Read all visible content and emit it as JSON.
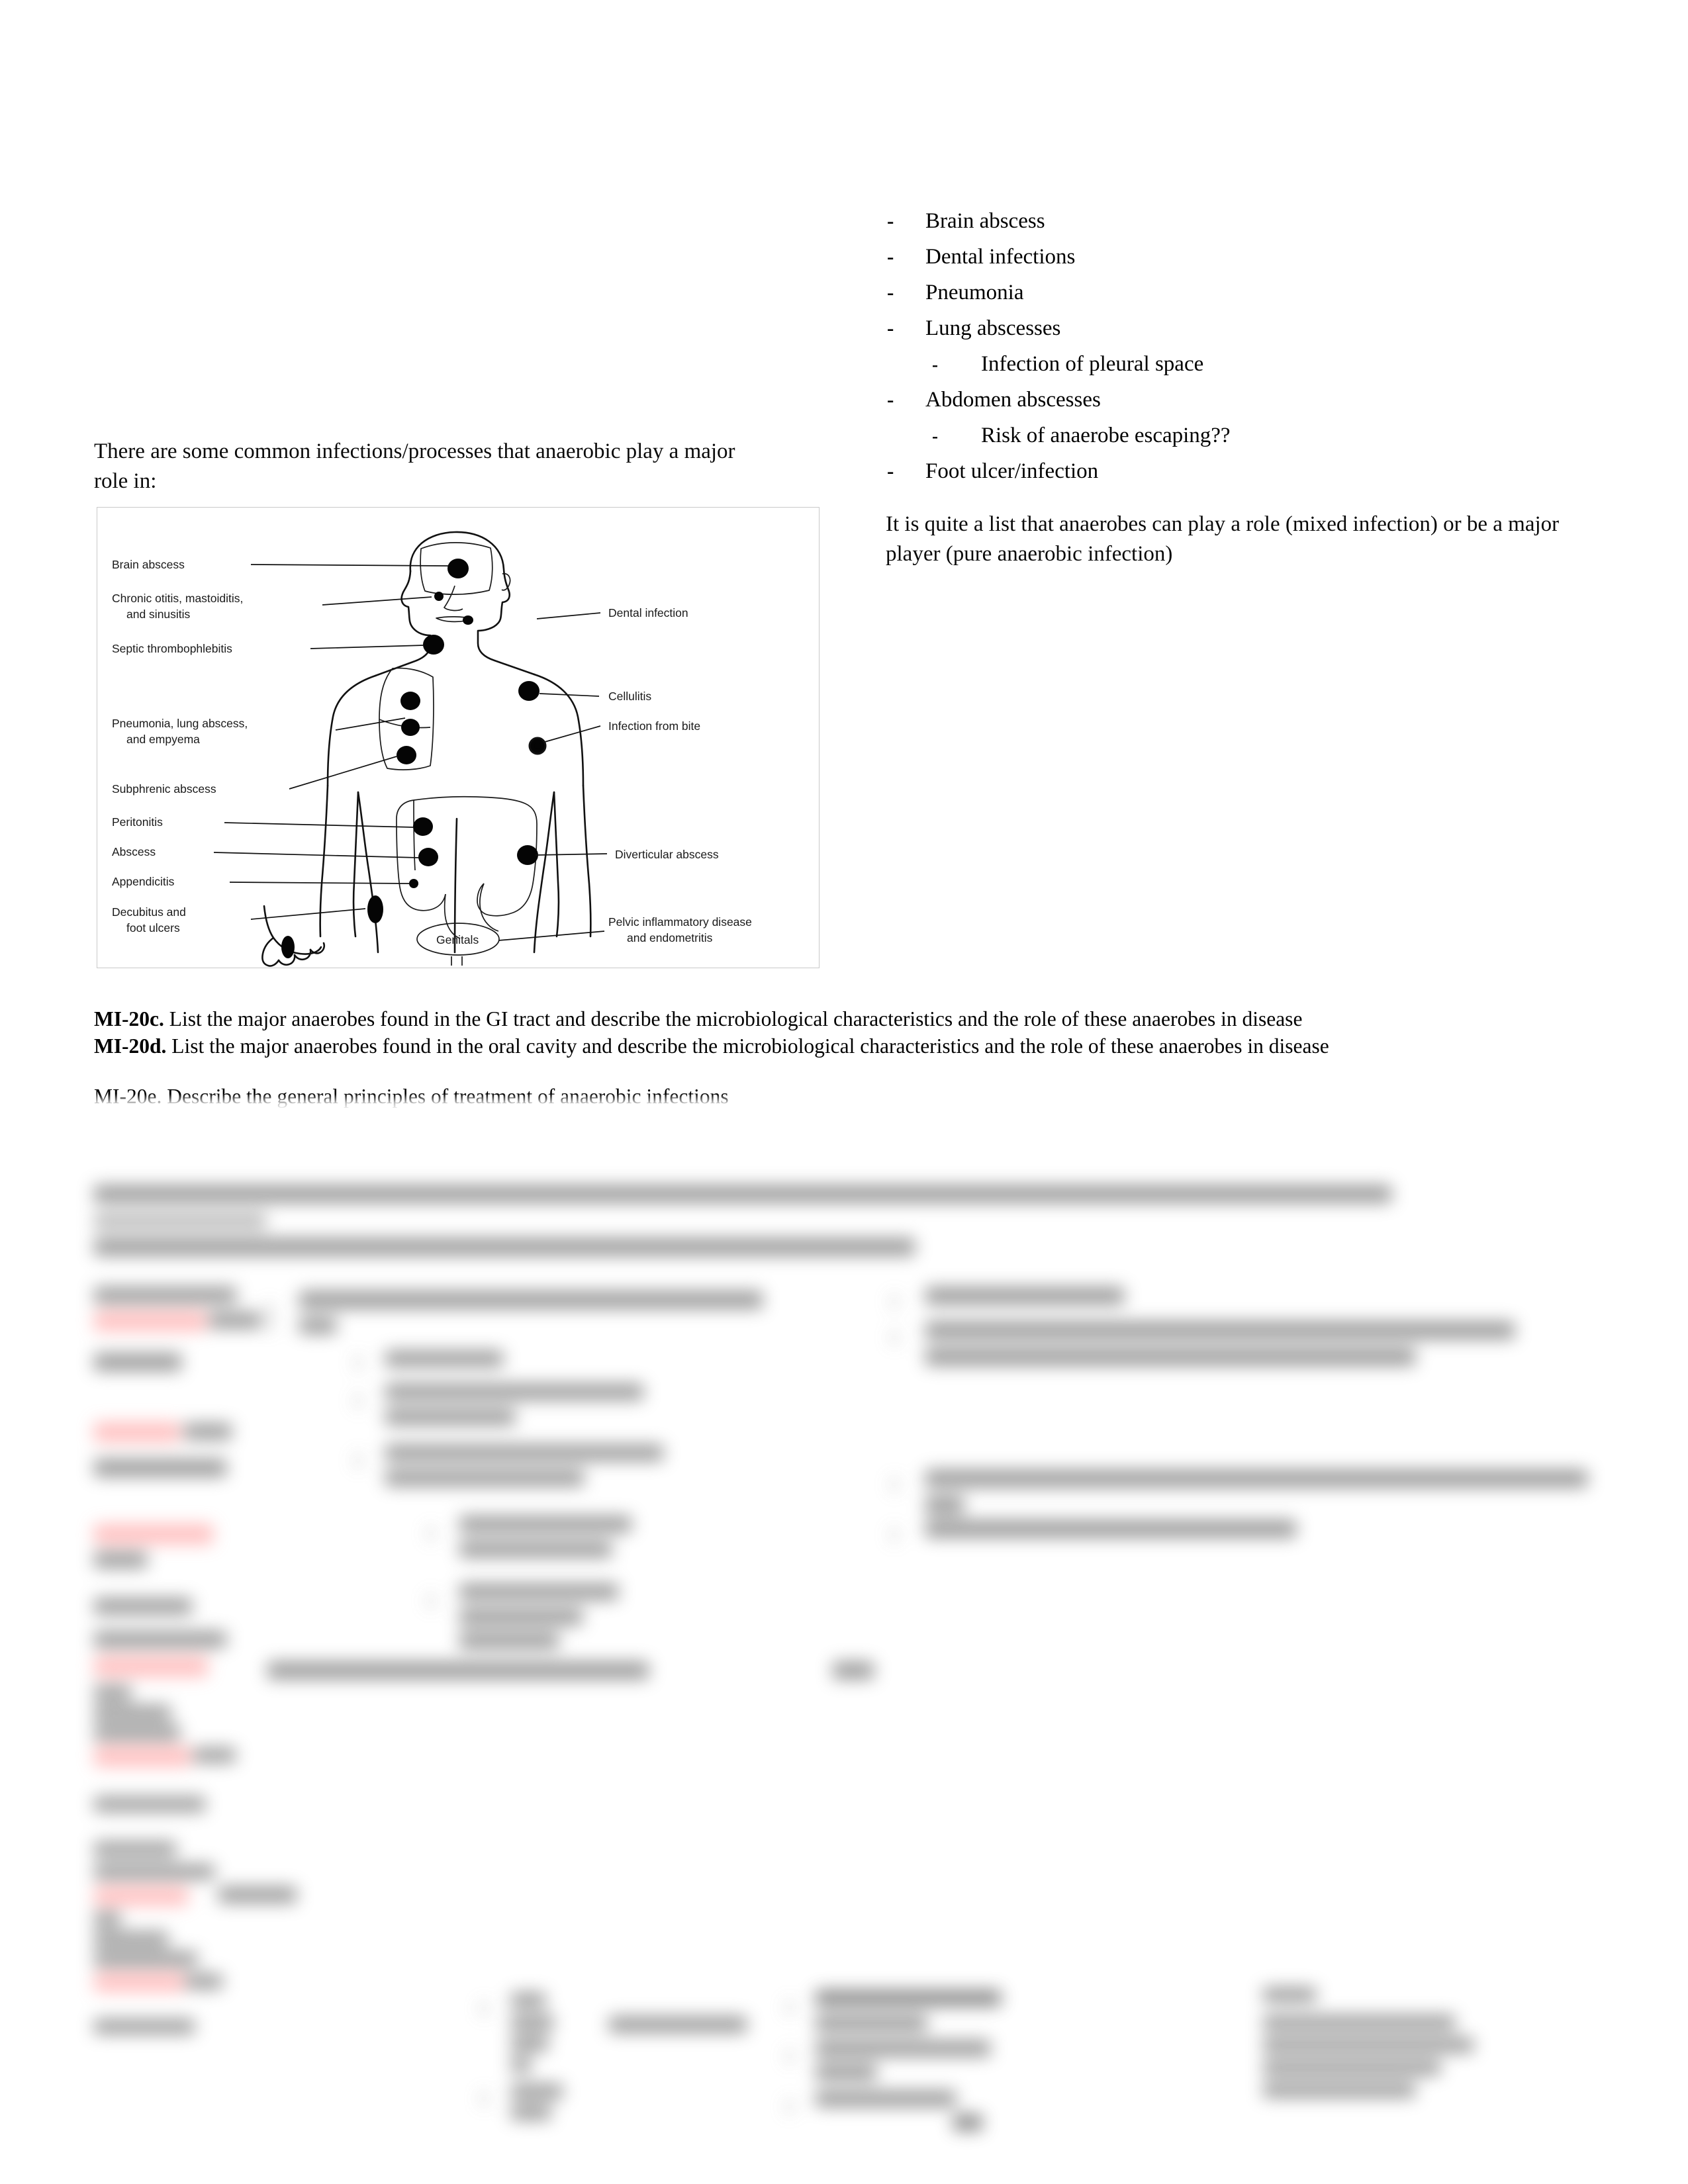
{
  "document": {
    "intro_paragraph": "There are some common infections/processes that anaerobic play a major role in:",
    "closing_paragraph": "It is quite a list that anaerobes can play a role (mixed infection) or be a major player (pure anaerobic infection)"
  },
  "bullets": [
    {
      "level": 1,
      "dash": "-",
      "text": "Brain abscess"
    },
    {
      "level": 1,
      "dash": "-",
      "text": "Dental infections"
    },
    {
      "level": 1,
      "dash": "-",
      "text": "Pneumonia"
    },
    {
      "level": 1,
      "dash": "-",
      "text": "Lung abscesses"
    },
    {
      "level": 2,
      "dash": "-",
      "text": "Infection of pleural space"
    },
    {
      "level": 1,
      "dash": "-",
      "text": "Abdomen abscesses"
    },
    {
      "level": 2,
      "dash": "-",
      "text": "Risk of anaerobe escaping??"
    },
    {
      "level": 1,
      "dash": "-",
      "text": "Foot ulcer/infection"
    }
  ],
  "figure": {
    "caption_center": "Genitals",
    "left_labels": [
      {
        "id": "brain-abscess",
        "text": "Brain abscess"
      },
      {
        "id": "chronic-otitis-1",
        "text": "Chronic otitis, mastoiditis,"
      },
      {
        "id": "chronic-otitis-2",
        "text": "and sinusitis"
      },
      {
        "id": "septic-thrombophlebitis",
        "text": "Septic thrombophlebitis"
      },
      {
        "id": "pneumonia-1",
        "text": "Pneumonia, lung abscess,"
      },
      {
        "id": "pneumonia-2",
        "text": "and empyema"
      },
      {
        "id": "subphrenic-abscess",
        "text": "Subphrenic abscess"
      },
      {
        "id": "peritonitis",
        "text": "Peritonitis"
      },
      {
        "id": "abscess",
        "text": "Abscess"
      },
      {
        "id": "appendicitis",
        "text": "Appendicitis"
      },
      {
        "id": "decubitus-1",
        "text": "Decubitus and"
      },
      {
        "id": "decubitus-2",
        "text": "foot ulcers"
      }
    ],
    "right_labels": [
      {
        "id": "dental-infection",
        "text": "Dental infection"
      },
      {
        "id": "cellulitis",
        "text": "Cellulitis"
      },
      {
        "id": "infection-from-bite",
        "text": "Infection from bite"
      },
      {
        "id": "diverticular-abscess",
        "text": "Diverticular abscess"
      },
      {
        "id": "pelvic-inflammatory-1",
        "text": "Pelvic inflammatory disease"
      },
      {
        "id": "pelvic-inflammatory-2",
        "text": "and endometritis"
      }
    ]
  },
  "objectives": [
    {
      "code": "MI-20c.",
      "text": " List the major anaerobes found in the GI tract and describe the microbiological characteristics and the role of these anaerobes in disease"
    },
    {
      "code": "MI-20d.",
      "text": " List the major anaerobes found in the oral cavity and describe the microbiological characteristics and the role of these anaerobes in disease"
    }
  ],
  "objective_partial": {
    "code": "MI-20e.",
    "text": " Describe the general principles of treatment of anaerobic infections"
  },
  "redacted_note": {
    "status": "blurred",
    "highlight_color": "#ff9a9a",
    "text_color": "#5b5b5b"
  }
}
